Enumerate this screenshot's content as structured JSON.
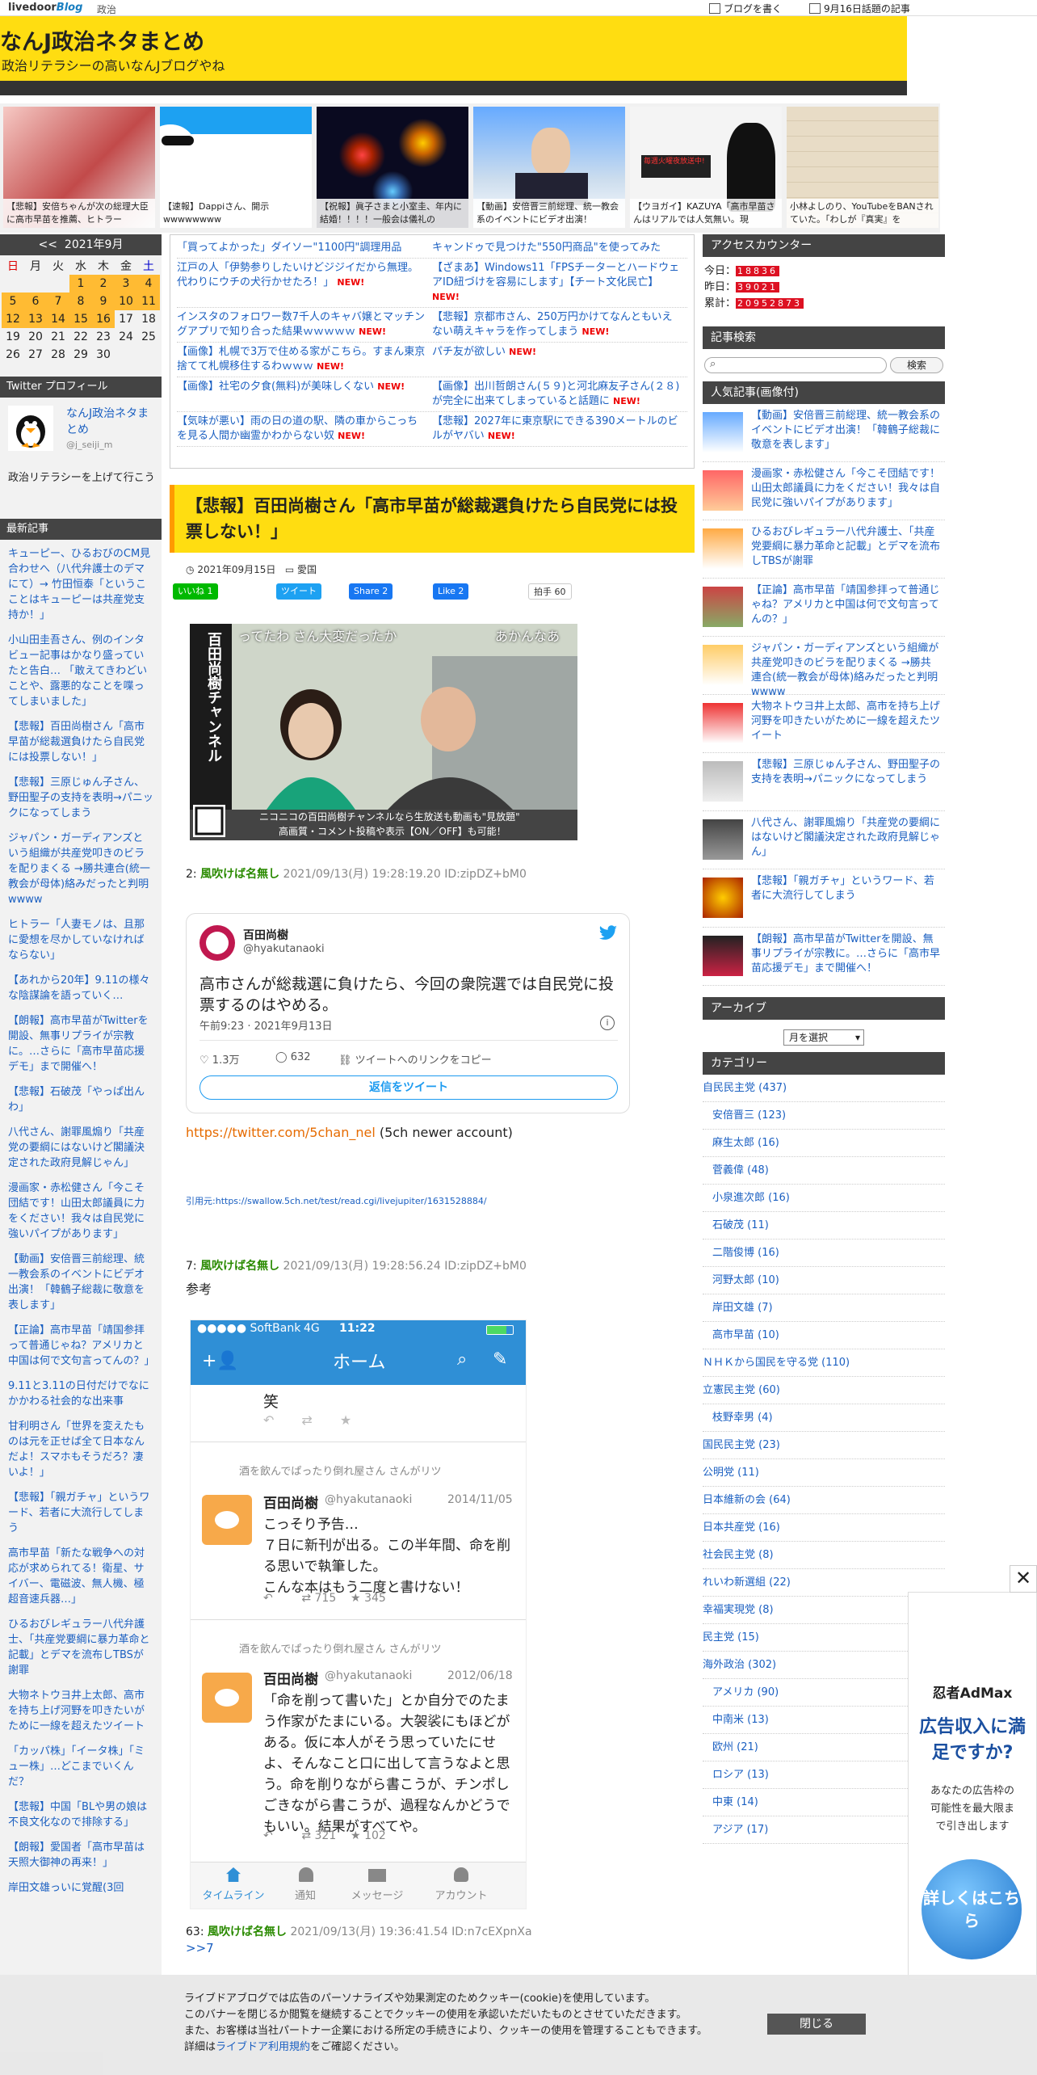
{
  "topbar": {
    "logo": "livedoor",
    "logo_blog": "Blog",
    "category": "政治",
    "write_blog": "ブログを書く",
    "topic": "9月16日話題の記事"
  },
  "header": {
    "title": "なんJ政治ネタまとめ",
    "subtitle": "政治リテラシーの高いなんJブログやね"
  },
  "thumbs": [
    {
      "caption": "【悲報】安倍ちゃんが次の総理大臣に高市早苗を推薦、ヒトラー"
    },
    {
      "caption": "【速報】Dappiさん、開示wwwwwwww"
    },
    {
      "caption": "【祝報】眞子さまと小室圭、年内に結婚！！！！一般会は儀礼の"
    },
    {
      "caption": "【動画】安倍晋三前総理、統一教会系のイベントにビデオ出演！"
    },
    {
      "caption": "【ウヨガイ】KAZUYA「高市早苗さんはリアルでは人気無い。現"
    },
    {
      "caption": "小林よしのり、YouTubeをBANされていた。「わしが『真実』を"
    }
  ],
  "calendar": {
    "prev": "<<",
    "month": "2021年9月",
    "weekdays": [
      "日",
      "月",
      "火",
      "水",
      "木",
      "金",
      "土"
    ],
    "weeks": [
      [
        "",
        "",
        "",
        "1",
        "2",
        "3",
        "4"
      ],
      [
        "5",
        "6",
        "7",
        "8",
        "9",
        "10",
        "11"
      ],
      [
        "12",
        "13",
        "14",
        "15",
        "16",
        "17",
        "18"
      ],
      [
        "19",
        "20",
        "21",
        "22",
        "23",
        "24",
        "25"
      ],
      [
        "26",
        "27",
        "28",
        "29",
        "30",
        "",
        ""
      ]
    ]
  },
  "profile": {
    "heading": "Twitter プロフィール",
    "name": "なんJ政治ネタまとめ",
    "id": "@j_seiji_m",
    "desc": "政治リテラシーを上げて行こう"
  },
  "recent": {
    "heading": "最新記事",
    "items": [
      "キューピー、ひるおびのCM見合わせへ（八代弁護士のデマにて）→ 竹田恒泰「というこことはキューピーは共産党支持か！」",
      "小山田圭吾さん、例のインタビュー記事はかなり盛っていたと告白… 「敢えてきわどいことや、露悪的なことを喋ってしまいました」",
      "【悲報】百田尚樹さん「高市早苗が総裁選負けたら自民党には投票しない！」",
      "【悲報】三原じゅん子さん、野田聖子の支持を表明→パニックになってしまう",
      "ジャパン・ガーディアンズという組織が共産党叩きのビラを配りまくる →勝共連合(統一教会が母体)絡みだったと判明wwww",
      "ヒトラー「人妻モノは、且那に愛想を尽かしていなければならない」",
      "【あれから20年】9.11の様々な陰謀論を語っていく…",
      "【朗報】高市早苗がTwitterを開設、無事リプライが宗教に。…さらに「高市早苗応援デモ」まで開催へ！",
      "【悲報】石破茂「やっぱ出んわ」",
      "八代さん、謝罪風煽り「共産党の要綱にはないけど閣議決定された政府見解じゃん」",
      "漫画家・赤松健さん「今こそ団結です！山田太郎議員に力をください！我々は自民党に強いパイプがあります」",
      "【動画】安倍晋三前総理、統一教会系のイベントにビデオ出演！「韓鶴子総裁に敬意を表します」",
      "【正論】高市早苗「靖国参拝って普通じゃね？アメリカと中国は何で文句言ってんの？」",
      "9.11と3.11の日付だけでなにかかわる社会的な出来事",
      "甘利明さん「世界を変えたものは元を正せば全て日本なんだよ！スマホもそうだろ？凄いよ！」",
      "【悲報】「親ガチャ」というワード、若者に大流行してしまう",
      "高市早苗「新たな戦争への対応が求められてる！衛星、サイバー、電磁波、無人機、極超音速兵器…」",
      "ひるおびレギュラー八代弁護士、「共産党要綱に暴力革命と記載」とデマを流布しTBSが謝罪",
      "大物ネトウヨ井上太郎、高市を持ち上げ河野を叩きたいがために一線を超えたツイート",
      "「カッパ株」「イータ株」「ミュー株」…どこまでいくんだ？",
      "【悲報】中国「BLや男の娘は不良文化なので排除する」",
      "【朗報】愛国者「高市早苗は天照大御神の再来！」",
      "岸田文雄っいに覚醒(3回"
    ]
  },
  "related": [
    [
      "「買ってよかった」ダイソー\"1100円\"調理用品",
      "キャンドゥで見つけた\"550円商品\"を使ってみた"
    ],
    [
      "江戸の人「伊勢参りしたいけどジジイだから無理。代わりにウチの犬行かせたろ！」",
      "【ざまあ】Windows11「FPSチーターとハードウェアID紐づけを容易にします」【チート文化民亡】"
    ],
    [
      "インスタのフォロワー数7千人のキャバ嬢とマッチングアプリで知り合った結果ｗｗｗｗｗ",
      "【悲報】京都市さん、250万円かけてなんともいえない萌えキャラを作ってしまう"
    ],
    [
      "【画像】札幌で3万で住める家がこちら。すまん東京捨てて札幌移住するわｗｗｗ",
      "パチ友が欲しい"
    ],
    [
      "【画像】社宅の夕食(無料)が美味しくない",
      "【画像】出川哲朗さん(５９)と河北麻友子さん(２８)が完全に出来てしまっていると話題に"
    ],
    [
      "【気味が悪い】雨の日の道の駅、隣の車からこっちを見る人間か幽霊かわからない奴",
      "【悲報】2027年に東京駅にできる390メートルのビルがヤバい"
    ]
  ],
  "new_label": "NEW!",
  "article": {
    "title": "【悲報】百田尚樹さん「高市早苗が総裁選負けたら自民党には投票しない！」",
    "date": "2021年09月15日",
    "category": "愛国",
    "share": {
      "line": "いいね 1",
      "tweet": "ツイート",
      "fb": "Share 2",
      "like": "Like 2",
      "clap": "拍手",
      "clap_count": "60"
    },
    "image_overlay": {
      "top_right": "あかんなあ",
      "top_left": "ってたわ さん大変だったか",
      "vertical": "百田尚樹チャンネル",
      "bottom1": "ニコニコの百田尚樹チャンネルなら生放送も動画も\"見放題\"",
      "bottom2": "高画質・コメント投稿や表示【ON／OFF】も可能！"
    }
  },
  "comments": [
    {
      "num": "2:",
      "name": "風吹けば名無し",
      "date": "2021/09/13(月) 19:28:19.20 ID:zipDZ+bM0",
      "body": ""
    },
    {
      "num": "7:",
      "name": "風吹けば名無し",
      "date": "2021/09/13(月) 19:28:56.24 ID:zipDZ+bM0",
      "body": "参考"
    },
    {
      "num": "63:",
      "name": "風吹けば名無し",
      "date": "2021/09/13(月) 19:36:41.54 ID:n7cEXpnXa",
      "body": ">>7"
    }
  ],
  "tweet": {
    "name": "百田尚樹",
    "handle": "@hyakutanaoki",
    "text": "高市さんが総裁選に負けたら、今回の衆院選では自民党に投票するのはやめる。",
    "time": "午前9:23 · 2021年9月13日",
    "likes": "1.3万",
    "replies": "632",
    "copy": "ツイートへのリンクをコピー",
    "reply_btn": "返信をツイート"
  },
  "tweet_link": {
    "url": "https://twitter.com/5chan_nel",
    "note": " (5ch newer account)"
  },
  "source": {
    "label": "引用元:",
    "url": "https://swallow.5ch.net/test/read.cgi/livejupiter/1631528884/"
  },
  "phone": {
    "carrier": "●●●●● SoftBank",
    "net": "4G",
    "time": "11:22",
    "title": "ホーム",
    "frag": "笑",
    "retweeter1": "酒を飲んでぱったり倒れ屋さん さんがリツ",
    "t1": {
      "name": "百田尚樹",
      "handle": "@hyakutanaoki",
      "date": "2014/11/05",
      "text": "こっそり予告…\n７日に新刊が出る。この半年間、命を削る思いで執筆した。\nこんな本はもう二度と書けない！",
      "rt": "715",
      "fav": "345"
    },
    "retweeter2": "酒を飲んでぱったり倒れ屋さん さんがリツ",
    "t2": {
      "name": "百田尚樹",
      "handle": "@hyakutanaoki",
      "date": "2012/06/18",
      "text": "「命を削って書いた」とか自分でのたまう作家がたまにいる。大袈裟にもほどがある。仮に本人がそう思っていたにせよ、そんなこと口に出して言うなよと思う。命を削りながら書こうが、チンポしごきながら書こうが、過程なんかどうでもいい。結果がすべてや。",
      "rt": "321",
      "fav": "102"
    },
    "tabs": [
      "タイムライン",
      "通知",
      "メッセージ",
      "アカウント"
    ]
  },
  "right": {
    "counter_head": "アクセスカウンター",
    "today_label": "今日：",
    "today": "18836",
    "yesterday_label": "昨日：",
    "yesterday": "39021",
    "total_label": "累計：",
    "total": "20952873",
    "search_head": "記事検索",
    "search_btn": "検索",
    "popular_head": "人気記事(画像付)",
    "popular": [
      "【動画】安倍晋三前総理、統一教会系のイベントにビデオ出演！「韓鶴子総裁に敬意を表します」",
      "漫画家・赤松健さん「今こそ団結です！山田太郎議員に力をください！我々は自民党に強いパイプがあります」",
      "ひるおびレギュラー八代弁護士、「共産党要綱に暴力革命と記載」とデマを流布しTBSが謝罪",
      "【正論】高市早苗「靖国参拝って普通じゃね？アメリカと中国は何で文句言ってんの？」",
      "ジャパン・ガーディアンズという組織が共産党叩きのビラを配りまくる →勝共連合(統一教会が母体)絡みだったと判明wwww",
      "大物ネトウヨ井上太郎、高市を持ち上げ河野を叩きたいがために一線を超えたツイート",
      "【悲報】三原じゅん子さん、野田聖子の支持を表明→パニックになってしまう",
      "八代さん、謝罪風煽り「共産党の要綱にはないけど閣議決定された政府見解じゃん」",
      "【悲報】「親ガチャ」というワード、若者に大流行してしまう",
      "【朗報】高市早苗がTwitterを開設、無事リプライが宗教に。…さらに「高市早苗応援デモ」まで開催へ！"
    ],
    "archive_head": "アーカイブ",
    "archive_select": "月を選択",
    "cat_head": "カテゴリー",
    "cats": [
      {
        "t": "自民民主党 (437)",
        "s": false
      },
      {
        "t": "安倍晋三 (123)",
        "s": true
      },
      {
        "t": "麻生太郎 (16)",
        "s": true
      },
      {
        "t": "菅義偉 (48)",
        "s": true
      },
      {
        "t": "小泉進次郎 (16)",
        "s": true
      },
      {
        "t": "石破茂 (11)",
        "s": true
      },
      {
        "t": "二階俊博 (16)",
        "s": true
      },
      {
        "t": "河野太郎 (10)",
        "s": true
      },
      {
        "t": "岸田文雄 (7)",
        "s": true
      },
      {
        "t": "高市早苗 (10)",
        "s": true
      },
      {
        "t": "ＮＨＫから国民を守る党 (110)",
        "s": false
      },
      {
        "t": "立憲民主党 (60)",
        "s": false
      },
      {
        "t": "枝野幸男 (4)",
        "s": true
      },
      {
        "t": "国民民主党 (23)",
        "s": false
      },
      {
        "t": "公明党 (11)",
        "s": false
      },
      {
        "t": "日本維新の会 (64)",
        "s": false
      },
      {
        "t": "日本共産党 (16)",
        "s": false
      },
      {
        "t": "社会民主党 (8)",
        "s": false
      },
      {
        "t": "れいわ新選組 (22)",
        "s": false
      },
      {
        "t": "幸福実現党 (8)",
        "s": false
      },
      {
        "t": "民主党 (15)",
        "s": false
      },
      {
        "t": "海外政治 (302)",
        "s": false
      },
      {
        "t": "アメリカ (90)",
        "s": true
      },
      {
        "t": "中南米 (13)",
        "s": true
      },
      {
        "t": "欧州 (21)",
        "s": true
      },
      {
        "t": "ロシア (13)",
        "s": true
      },
      {
        "t": "中東 (14)",
        "s": true
      },
      {
        "t": "アジア (17)",
        "s": true
      }
    ]
  },
  "ad": {
    "brand": "忍者AdMax",
    "headline": "広告収入に満足ですか?",
    "body": "あなたの広告枠の可能性を最大限まで引き出します",
    "cta": "詳しくはこちら"
  },
  "cookie": {
    "l1": "ライブドアブログでは広告のパーソナライズや効果測定のためクッキー(cookie)を使用しています。",
    "l2": "このバナーを閉じるか閲覧を継続することでクッキーの使用を承認いただいたものとさせていただきます。",
    "l3": "また、お客様は当社パートナー企業における所定の手続きにより、クッキーの使用を管理することもできます。",
    "l4a": "詳細は",
    "l4link": "ライブドア利用規約",
    "l4b": "をご確認ください。",
    "close": "閉じる"
  }
}
